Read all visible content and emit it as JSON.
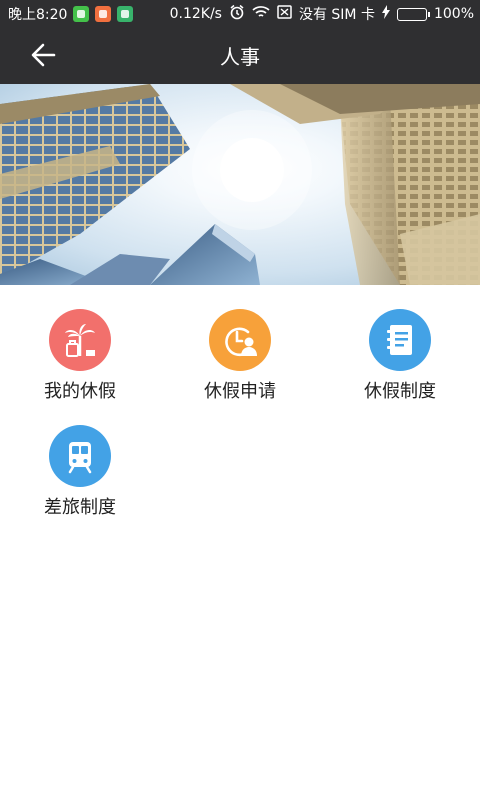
{
  "status_bar": {
    "time": "晚上8:20",
    "speed": "0.12K/s",
    "carrier": "没有 SIM 卡",
    "battery": "100%",
    "battery_level": 1.0
  },
  "header": {
    "title": "人事",
    "back_icon": "arrow-left-icon"
  },
  "menu": {
    "items": [
      {
        "label": "我的休假",
        "icon": "palm-tree-suitcase-icon",
        "color": "#f2706c"
      },
      {
        "label": "休假申请",
        "icon": "clock-person-icon",
        "color": "#f7a13a"
      },
      {
        "label": "休假制度",
        "icon": "notebook-icon",
        "color": "#43a2e6"
      },
      {
        "label": "差旅制度",
        "icon": "train-icon",
        "color": "#43a2e6"
      }
    ]
  },
  "colors": {
    "app_bar": "#2f2f31",
    "background": "#ffffff"
  }
}
